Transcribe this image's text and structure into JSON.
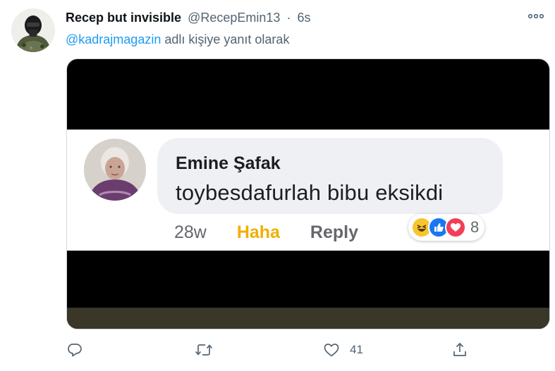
{
  "tweet": {
    "author_name": "Recep but invisible",
    "handle": "@RecepEmin13",
    "separator": "·",
    "time": "6s",
    "reply_to": {
      "mention": "@kadrajmagazin",
      "text": "adlı kişiye yanıt olarak"
    },
    "media": {
      "commenter_name": "Emine Şafak",
      "comment_text": "toybesdafurlah bibu eksikdi",
      "comment_time": "28w",
      "haha_label": "Haha",
      "reply_label": "Reply",
      "reaction_count": "8",
      "reaction_icons": [
        "haha-emoji-icon",
        "like-emoji-icon",
        "love-emoji-icon"
      ]
    },
    "actions": {
      "like_count": "41"
    }
  },
  "icons": {
    "more": "more-dots-icon",
    "reply": "comment-bubble-icon",
    "retweet": "retweet-icon",
    "like": "heart-icon",
    "share": "share-icon"
  },
  "colors": {
    "link": "#1d9bf0",
    "secondary_text": "#536471",
    "haha": "#f0b000",
    "fb_like": "#1877f2",
    "fb_love": "#f33e58"
  }
}
